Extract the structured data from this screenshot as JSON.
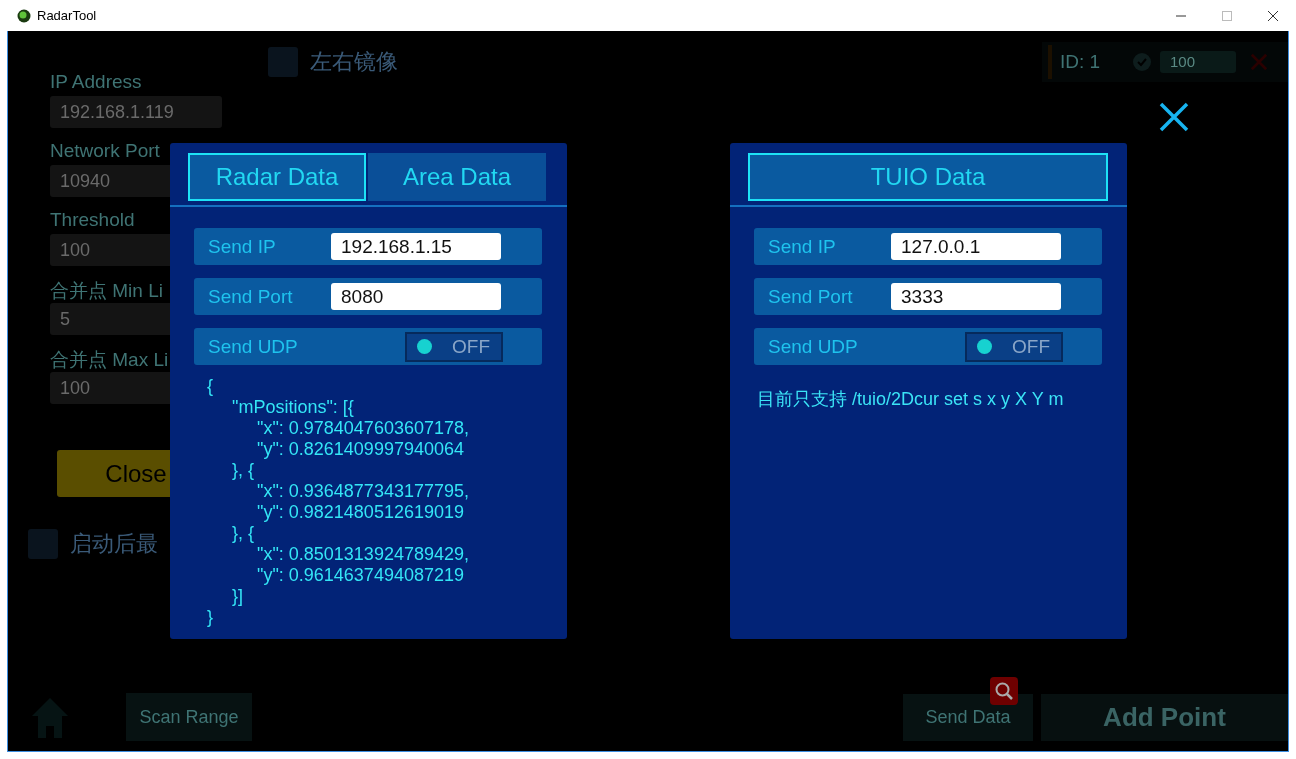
{
  "window": {
    "title": "RadarTool"
  },
  "settings": {
    "fields": [
      {
        "label": "IP Address",
        "value": "192.168.1.119"
      },
      {
        "label": "Network Port",
        "value": "10940"
      },
      {
        "label": "Threshold",
        "value": "100"
      },
      {
        "label": "合并点 Min Li",
        "value": "5"
      },
      {
        "label": "合并点 Max Li",
        "value": "100"
      }
    ],
    "close_button": "Close",
    "minimize_on_start": {
      "label": "启动后最",
      "checked": false
    }
  },
  "mirror": {
    "label": "左右镜像",
    "checked": false
  },
  "point": {
    "id": "ID: 1",
    "checked": true,
    "value": "100"
  },
  "bottom": {
    "scan_range": "Scan Range",
    "send_data": "Send Data",
    "add_point": "Add Point"
  },
  "panels": [
    {
      "tabs": [
        {
          "label": "Radar Data",
          "selected": true
        },
        {
          "label": "Area Data",
          "selected": false
        }
      ],
      "rows": [
        {
          "kind": "input",
          "label": "Send IP",
          "value": "192.168.1.15"
        },
        {
          "kind": "input",
          "label": "Send Port",
          "value": "8080"
        },
        {
          "kind": "toggle",
          "label": "Send UDP",
          "on": false,
          "state": "OFF"
        }
      ],
      "body": {
        "kind": "code",
        "lines": [
          "{",
          "     \"mPositions\": [{",
          "          \"x\": 0.9784047603607178,",
          "          \"y\": 0.8261409997940064",
          "     }, {",
          "          \"x\": 0.9364877343177795,",
          "          \"y\": 0.9821480512619019",
          "     }, {",
          "          \"x\": 0.8501313924789429,",
          "          \"y\": 0.9614637494087219",
          "     }]",
          "}"
        ]
      }
    },
    {
      "tabs": [
        {
          "label": "TUIO Data",
          "selected": true
        }
      ],
      "rows": [
        {
          "kind": "input",
          "label": "Send IP",
          "value": "127.0.0.1"
        },
        {
          "kind": "input",
          "label": "Send Port",
          "value": "3333"
        },
        {
          "kind": "toggle",
          "label": "Send UDP",
          "on": false,
          "state": "OFF"
        }
      ],
      "body": {
        "kind": "note",
        "text": "目前只支持 /tuio/2Dcur set s x y X Y m"
      }
    }
  ]
}
